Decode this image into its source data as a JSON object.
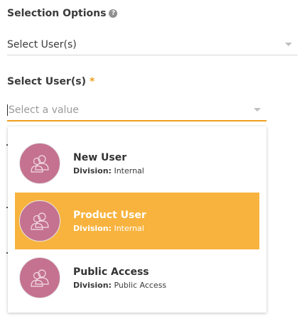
{
  "colors": {
    "accent": "#f0a020",
    "highlight_bg": "#f8b33e",
    "avatar_bg": "#c4728f",
    "divider": "#d6d6d6"
  },
  "selection_options": {
    "label": "Selection Options",
    "help_icon": "?",
    "value": "Select User(s)"
  },
  "select_users": {
    "label": "Select User(s)",
    "required_marker": "*",
    "placeholder": "Select a value"
  },
  "options": [
    {
      "name": "New User",
      "division_label": "Division:",
      "division_value": "Internal",
      "avatar_icon": "users-icon"
    },
    {
      "name": "Product User",
      "division_label": "Division:",
      "division_value": "Internal",
      "avatar_icon": "users-icon",
      "highlighted": true
    },
    {
      "name": "Public Access",
      "division_label": "Division:",
      "division_value": "Public Access",
      "avatar_icon": "users-icon"
    }
  ]
}
